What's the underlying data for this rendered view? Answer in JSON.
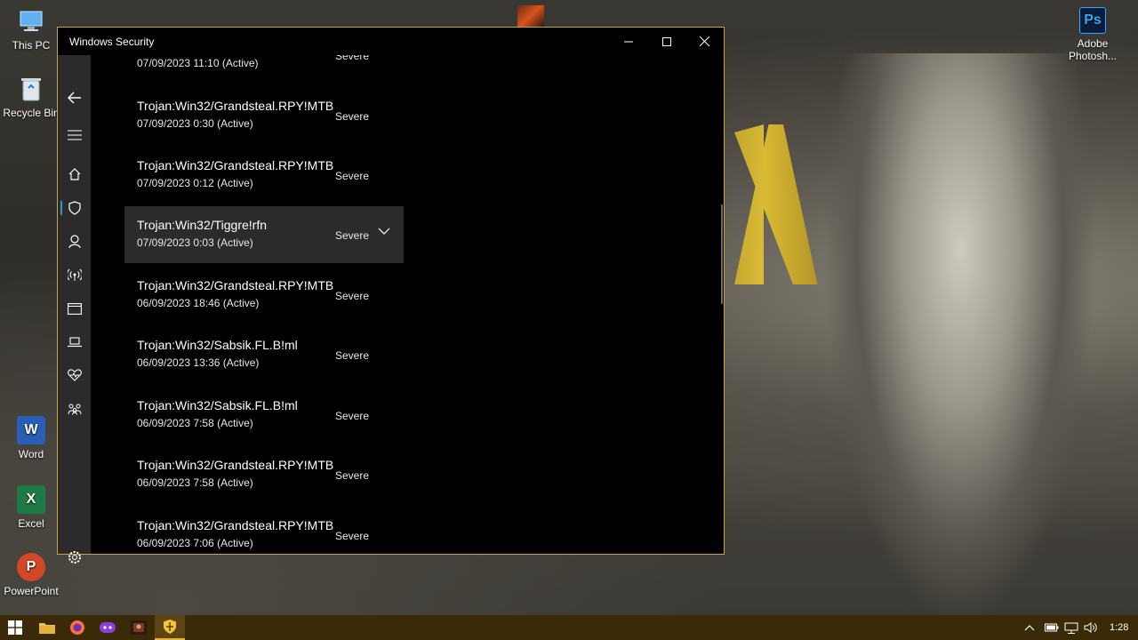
{
  "desktop": {
    "icons": [
      {
        "label": "This PC"
      },
      {
        "label": "Recycle Bin"
      },
      {
        "label": "Word"
      },
      {
        "label": "Excel"
      },
      {
        "label": "PowerPoint"
      },
      {
        "label": "Adobe Photosh..."
      }
    ]
  },
  "window": {
    "title": "Windows Security",
    "controls": {
      "minimize": "—",
      "maximize": "☐",
      "close": "✕"
    }
  },
  "threats": [
    {
      "name": "",
      "date": "07/09/2023 11:10 (Active)",
      "severity": "Severe"
    },
    {
      "name": "Trojan:Win32/Grandsteal.RPY!MTB",
      "date": "07/09/2023 0:30 (Active)",
      "severity": "Severe"
    },
    {
      "name": "Trojan:Win32/Grandsteal.RPY!MTB",
      "date": "07/09/2023 0:12 (Active)",
      "severity": "Severe"
    },
    {
      "name": "Trojan:Win32/Tiggre!rfn",
      "date": "07/09/2023 0:03 (Active)",
      "severity": "Severe",
      "selected": true
    },
    {
      "name": "Trojan:Win32/Grandsteal.RPY!MTB",
      "date": "06/09/2023 18:46 (Active)",
      "severity": "Severe"
    },
    {
      "name": "Trojan:Win32/Sabsik.FL.B!ml",
      "date": "06/09/2023 13:36 (Active)",
      "severity": "Severe"
    },
    {
      "name": "Trojan:Win32/Sabsik.FL.B!ml",
      "date": "06/09/2023 7:58 (Active)",
      "severity": "Severe"
    },
    {
      "name": "Trojan:Win32/Grandsteal.RPY!MTB",
      "date": "06/09/2023 7:58 (Active)",
      "severity": "Severe"
    },
    {
      "name": "Trojan:Win32/Grandsteal.RPY!MTB",
      "date": "06/09/2023 7:06 (Active)",
      "severity": "Severe"
    }
  ],
  "taskbar": {
    "clock": "1:28",
    "accent": "#e2b33a"
  },
  "colors": {
    "window_border": "#c9a43a",
    "sidebar_active": "#3b8fd9",
    "selected_row": "#2b2b2b"
  }
}
